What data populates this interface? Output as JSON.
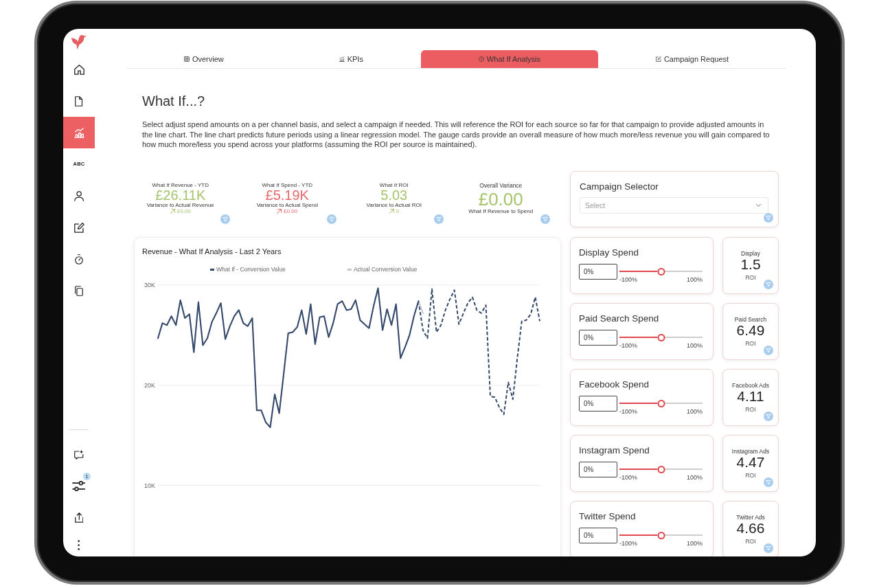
{
  "sidebar": {
    "items": [
      {
        "kind": "icon",
        "selected": false
      },
      {
        "kind": "icon",
        "selected": false
      },
      {
        "kind": "icon",
        "selected": true
      },
      {
        "kind": "text",
        "label": "ABC",
        "selected": false
      },
      {
        "kind": "icon",
        "selected": false
      },
      {
        "kind": "icon",
        "selected": false
      },
      {
        "kind": "icon",
        "selected": false
      },
      {
        "kind": "icon",
        "selected": false
      }
    ],
    "bottom_items": [
      {
        "kind": "icon"
      },
      {
        "kind": "icon",
        "badge": "1"
      },
      {
        "kind": "icon"
      },
      {
        "kind": "icon"
      }
    ]
  },
  "tabs": [
    {
      "label": "Overview",
      "selected": false
    },
    {
      "label": "KPIs",
      "selected": false
    },
    {
      "label": "What If Analysis",
      "selected": true
    },
    {
      "label": "Campaign Request",
      "selected": false
    }
  ],
  "page": {
    "title": "What If...?",
    "description": "Select adjust spend amounts on a per channel basis, and select a campaign if needed. This will reference the ROI for each source so far for that campaign to provide adjusted amounts in the line chart. The line chart predicts future periods using a linear regression model. The gauge cards provide an overall measure of how much more/less revenue you will gain compared to how much more/less you spend across your platforms (assuming the ROI per source is maintained)."
  },
  "kpis": [
    {
      "kind": "variance",
      "label": "What If Revenue - YTD",
      "value": "£26.11K",
      "caption": "Variance to Actual Revenue",
      "variance": "£0.00",
      "color": "#a5c46c"
    },
    {
      "kind": "variance",
      "label": "What If Spend - YTD",
      "value": "£5.19K",
      "caption": "Variance to Actual Spend",
      "variance": "£0.00",
      "color": "#e8696c"
    },
    {
      "kind": "variance",
      "label": "What If ROI",
      "value": "5.03",
      "caption": "Variance to Actual ROI",
      "variance": "0",
      "color": "#a5c46c"
    },
    {
      "kind": "summary",
      "label": "Overall Variance",
      "value": "£0.00",
      "caption": "What If Revenue to Spend",
      "color": "#a5c46c"
    }
  ],
  "chart": {
    "chart_data": {
      "type": "line",
      "title": "Revenue - What If Analysis - Last 2 Years",
      "ylim": [
        10000,
        30000
      ],
      "yticks": [
        {
          "value": 10000,
          "label": "10K"
        },
        {
          "value": 20000,
          "label": "20K"
        },
        {
          "value": 30000,
          "label": "30K"
        }
      ],
      "series": [
        {
          "name": "What If - Conversion Value",
          "color": "#34486b",
          "line_style": "solid",
          "values": [
            24700,
            26200,
            26000,
            26900,
            26000,
            28500,
            26700,
            27100,
            23300,
            28300,
            24000,
            24700,
            26300,
            27200,
            28200,
            24600,
            25900,
            26900,
            27500,
            26200,
            25900,
            26700,
            17500,
            17500,
            16300,
            15800,
            19100,
            17200,
            21200,
            25200,
            25300,
            25800,
            27500,
            25100,
            28100,
            24100,
            26800,
            26900,
            24800,
            26200,
            28100,
            28400,
            27500,
            27600,
            28500,
            26500,
            26100,
            25700,
            27900,
            29700,
            25500,
            27600,
            26000,
            28100,
            22700,
            23800,
            25000,
            26900,
            28400
          ]
        },
        {
          "name": "Actual Conversion Value",
          "color": "#c2c8d2",
          "line_style": "solid",
          "values": [
            24700,
            26200,
            26000,
            26900,
            26000,
            28500,
            26700,
            27100,
            23300,
            28300,
            24000,
            24700,
            26300,
            27200,
            28200,
            24600,
            25900,
            26900,
            27500,
            26200,
            25900,
            26700,
            17500,
            17500,
            16300,
            15800,
            19100,
            17200,
            21200,
            25200,
            25300,
            25800,
            27500,
            25100,
            28100,
            24100,
            26800,
            26900,
            24800,
            26200,
            28100,
            28400,
            27500,
            27600,
            28500,
            26500,
            26100,
            25700,
            27900,
            29700,
            25500,
            27600,
            26000,
            28100,
            22700,
            23800,
            25000,
            26900,
            28400,
            27200
          ]
        },
        {
          "color": "#34486b",
          "line_style": "dashed",
          "values": [
            null,
            null,
            null,
            null,
            null,
            null,
            null,
            null,
            null,
            null,
            null,
            null,
            null,
            null,
            null,
            null,
            null,
            null,
            null,
            null,
            null,
            null,
            null,
            null,
            null,
            null,
            null,
            null,
            null,
            null,
            null,
            null,
            null,
            null,
            null,
            null,
            null,
            null,
            null,
            null,
            null,
            null,
            null,
            null,
            null,
            null,
            null,
            null,
            null,
            null,
            null,
            null,
            null,
            null,
            null,
            null,
            null,
            null,
            28400,
            25500,
            24700,
            29600,
            25300,
            26000,
            27500,
            28600,
            29500,
            26100,
            27200,
            28200,
            28800,
            27500,
            27200,
            28000,
            18900,
            18800,
            17800,
            17100,
            20300,
            18600,
            22700,
            26400,
            26500,
            27100,
            28800,
            26400
          ]
        }
      ]
    }
  },
  "campaign_selector": {
    "title": "Campaign Selector",
    "placeholder": "Select"
  },
  "channels": [
    {
      "title": "Display Spend",
      "value": "0%",
      "level": 0.5,
      "min_label": "-100%",
      "max_label": "100%",
      "roi_label": "Display",
      "roi": "1.5",
      "roi_caption": "ROI"
    },
    {
      "title": "Paid Search Spend",
      "value": "0%",
      "level": 0.5,
      "min_label": "-100%",
      "max_label": "100%",
      "roi_label": "Paid Search",
      "roi": "6.49",
      "roi_caption": "ROI"
    },
    {
      "title": "Facebook Spend",
      "value": "0%",
      "level": 0.5,
      "min_label": "-100%",
      "max_label": "100%",
      "roi_label": "Facebook Ads",
      "roi": "4.11",
      "roi_caption": "ROI"
    },
    {
      "title": "Instagram Spend",
      "value": "0%",
      "level": 0.5,
      "min_label": "-100%",
      "max_label": "100%",
      "roi_label": "Instagram Ads",
      "roi": "4.47",
      "roi_caption": "ROI"
    },
    {
      "title": "Twitter Spend",
      "value": "0%",
      "level": 0.5,
      "min_label": "-100%",
      "max_label": "100%",
      "roi_label": "Twitter Ads",
      "roi": "4.66",
      "roi_caption": "ROI"
    }
  ]
}
